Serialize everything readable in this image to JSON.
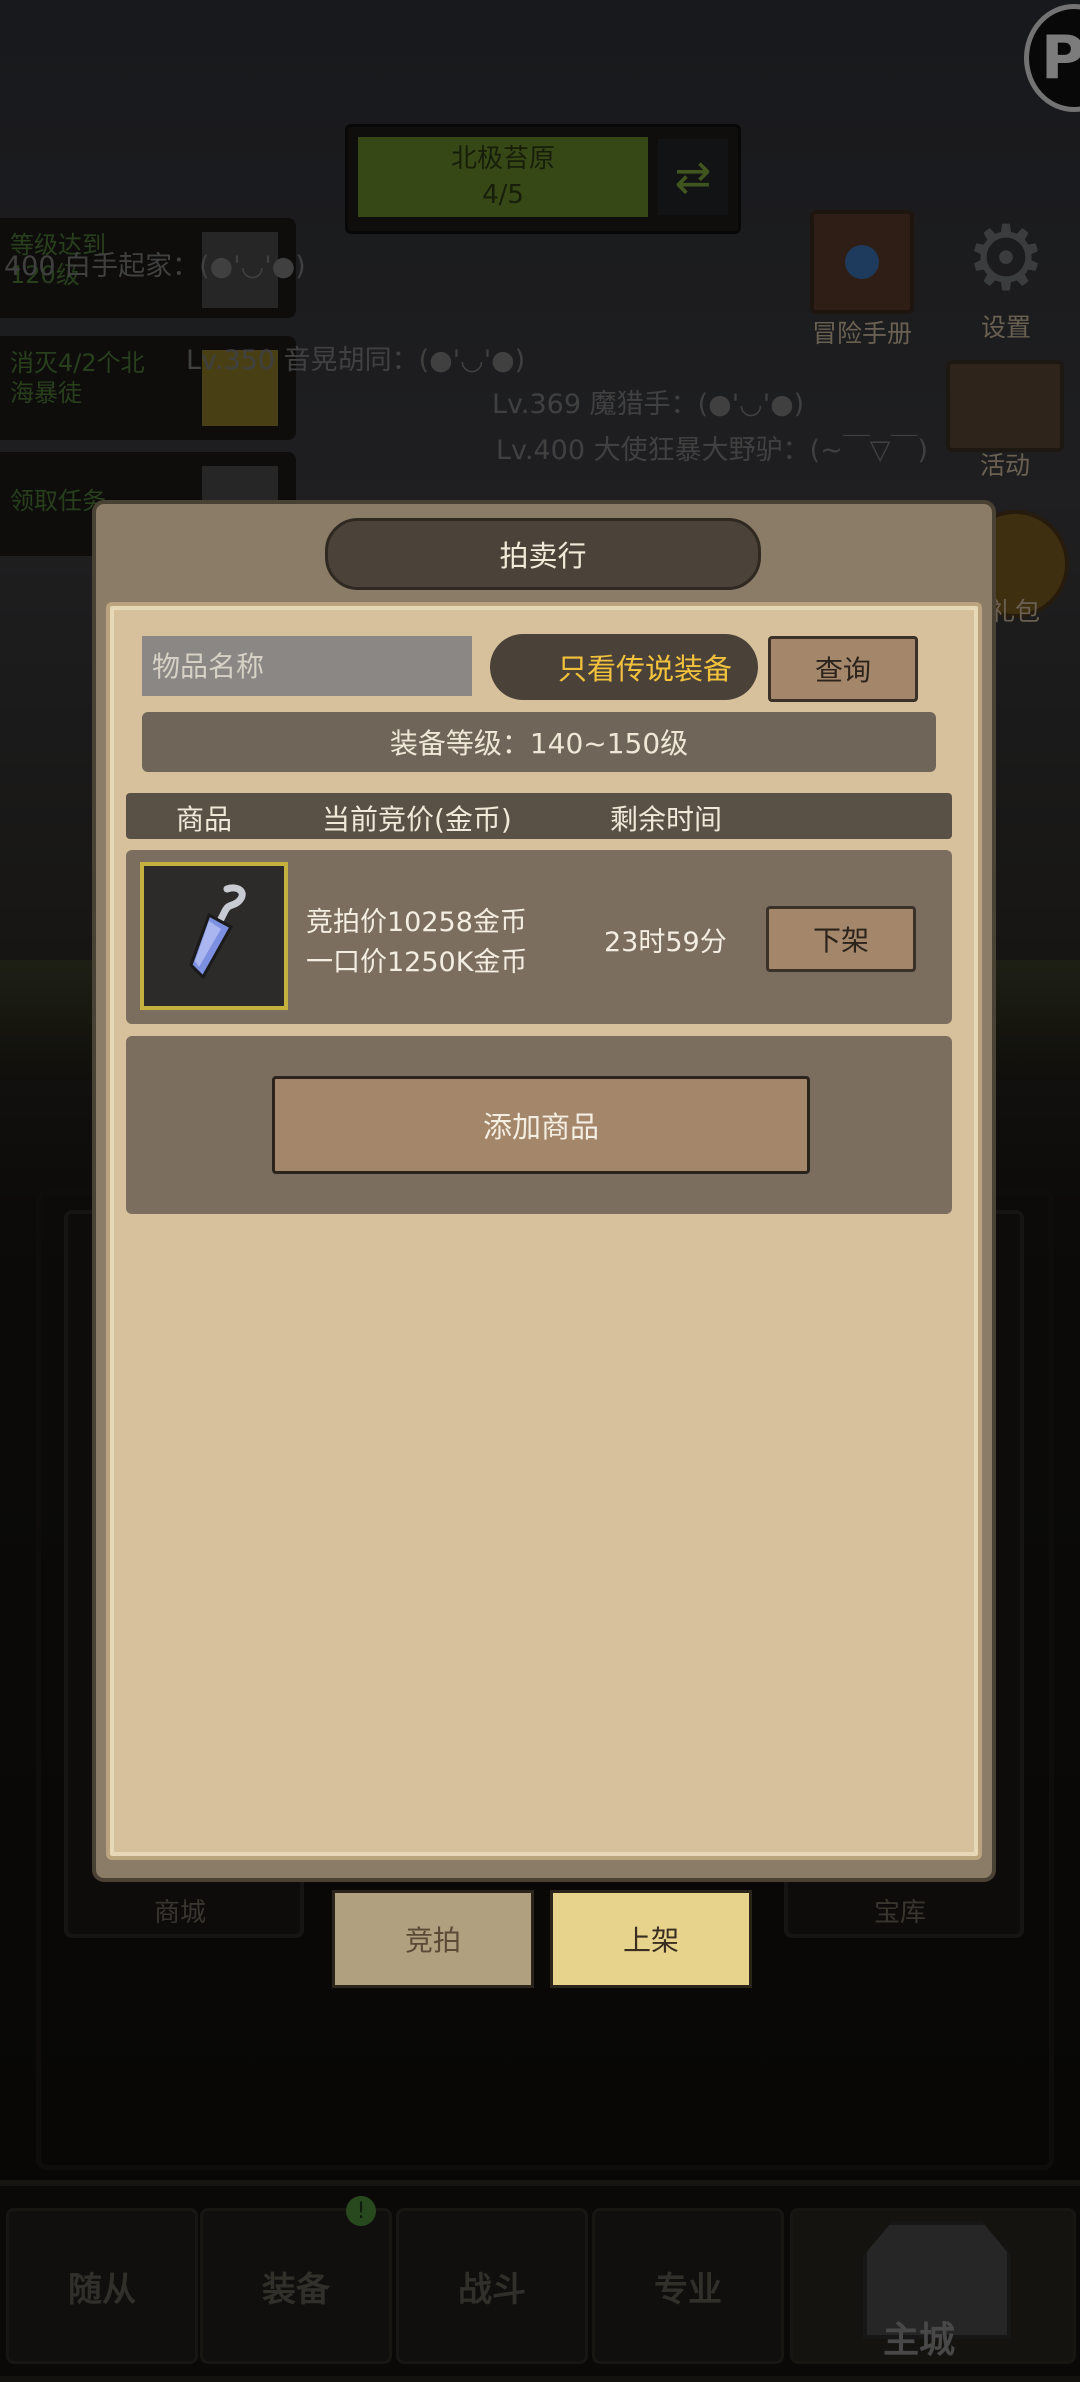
{
  "region": {
    "name": "北极苔原",
    "progress": "4/5"
  },
  "quests": [
    {
      "line1": "等级达到",
      "line2": "120级"
    },
    {
      "line1": "消灭4/2个北",
      "line2": "海暴徒"
    },
    {
      "line1": "领取任务",
      "line2": ""
    }
  ],
  "chat_log": [
    "400 白手起家：(●'◡'●)",
    "Lv.350 音晃胡同：(●'◡'●)",
    "Lv.369 魔猎手：(●'◡'●)",
    "Lv.400 大使狂暴大野驴：(~￣▽￣)"
  ],
  "hud": {
    "adventure_book": "冒险手册",
    "settings": "设置",
    "activity": "活动",
    "gift_pack": "礼包"
  },
  "town": {
    "shop": "商城",
    "vault": "宝库"
  },
  "tabs": {
    "bid": "竞拍",
    "list": "上架"
  },
  "nav": {
    "followers": "随从",
    "equipment": "装备",
    "battle": "战斗",
    "profession": "专业",
    "main_city": "主城"
  },
  "auction": {
    "title": "拍卖行",
    "search_placeholder": "物品名称",
    "legend_only": "只看传说装备",
    "query": "查询",
    "level_range": "装备等级：140~150级",
    "columns": {
      "item": "商品",
      "current_bid": "当前竞价(金币)",
      "time_left": "剩余时间"
    },
    "listings": [
      {
        "bid_price": "竞拍价10258金币",
        "buyout_price": "一口价1250K金币",
        "time_left": "23时59分",
        "action": "下架"
      }
    ],
    "add_item": "添加商品"
  },
  "colors": {
    "legend_toggle_text": "#f2c23c",
    "selected_tab": "#e8d38c",
    "region_bar": "#6a8a2c"
  }
}
